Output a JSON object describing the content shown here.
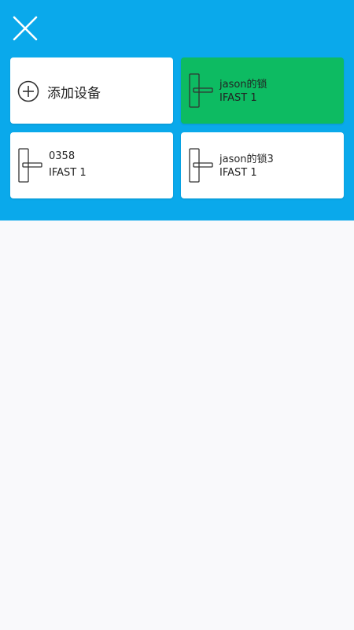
{
  "header": {
    "close_icon": "close-icon"
  },
  "add_device": {
    "label": "添加设备",
    "icon": "plus-circle-icon"
  },
  "devices": [
    {
      "name": "jason的锁",
      "model": "IFAST 1",
      "selected": true,
      "icon": "door-lock-icon"
    },
    {
      "name": "0358",
      "model": "IFAST 1",
      "selected": false,
      "icon": "door-lock-icon"
    },
    {
      "name": "jason的锁3",
      "model": "IFAST 1",
      "selected": false,
      "icon": "door-lock-icon"
    }
  ],
  "colors": {
    "header_bg": "#0aa9eb",
    "selected_card": "#0dbb62",
    "card_bg": "#ffffff",
    "page_bg": "#f9f9fb"
  }
}
